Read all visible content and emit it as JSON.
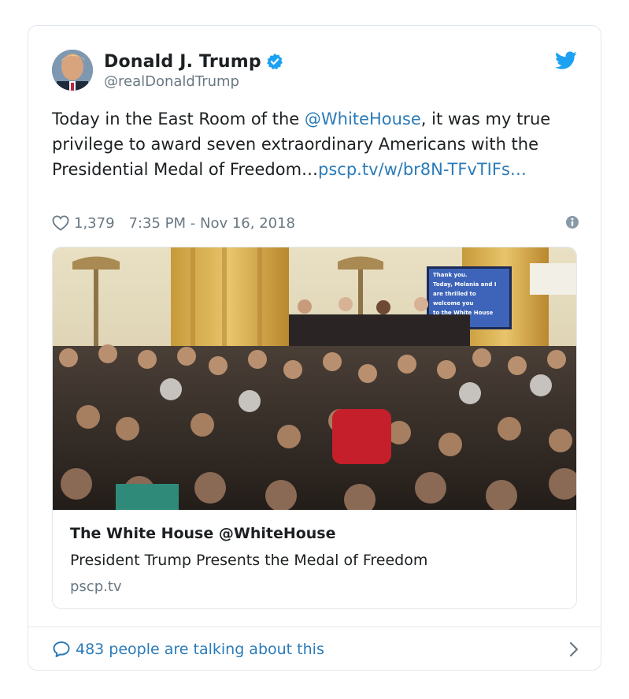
{
  "author": {
    "display_name": "Donald J. Trump",
    "handle": "@realDonaldTrump",
    "verified": true
  },
  "tweet": {
    "text_before": "Today in the East Room of the ",
    "mention": "@WhiteHouse",
    "text_after": ", it was my true privilege to award seven extraordinary Americans with the Presidential Medal of Freedom…",
    "link": "pscp.tv/w/br8N-TFvTIFs…"
  },
  "meta": {
    "likes": "1,379",
    "timestamp": "7:35 PM - Nov 16, 2018"
  },
  "media_card": {
    "title": "The White House @WhiteHouse",
    "description": "President Trump Presents the Medal of Freedom",
    "domain": "pscp.tv",
    "screen_text": [
      "Thank you.",
      "Today, Melania and I",
      "are thrilled to",
      "welcome you",
      "to the White House"
    ]
  },
  "footer": {
    "talking": "483 people are talking about this"
  },
  "colors": {
    "link": "#2b7bb9",
    "secondary": "#697882",
    "twitter_blue": "#1da1f2",
    "border": "#e1e8ed"
  },
  "icons": [
    "verified-badge-icon",
    "twitter-bird-icon",
    "heart-icon",
    "info-icon",
    "speech-bubble-icon",
    "chevron-right-icon"
  ]
}
